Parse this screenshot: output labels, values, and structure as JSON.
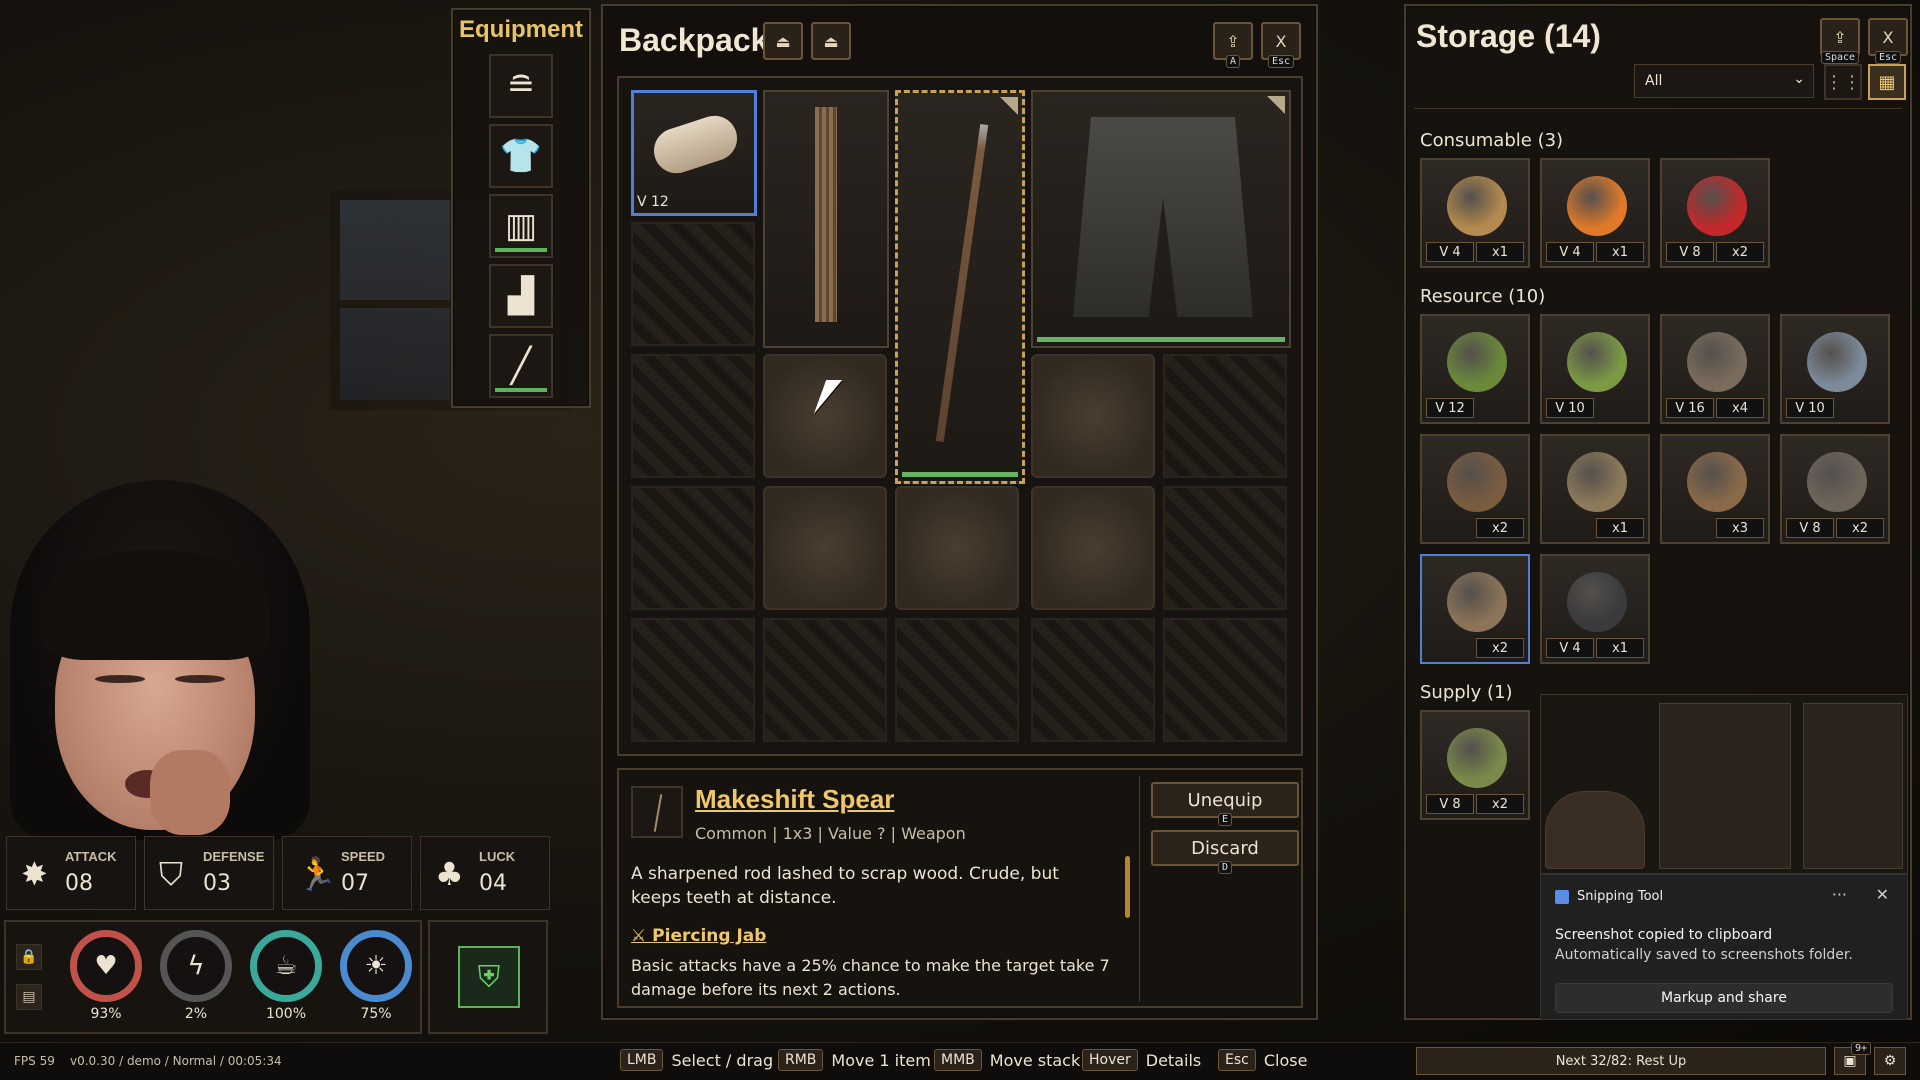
{
  "equipment": {
    "title": "Equipment",
    "slots": [
      {
        "icon": "head-icon",
        "glyph": "≘"
      },
      {
        "icon": "shirt-icon",
        "glyph": "👕"
      },
      {
        "icon": "pants-icon",
        "glyph": "▥"
      },
      {
        "icon": "boot-icon",
        "glyph": "▟"
      },
      {
        "icon": "spear-icon",
        "glyph": "╱"
      }
    ]
  },
  "backpack": {
    "title": "Backpack",
    "sort_buttons": [
      {
        "icon": "sort-icon",
        "glyph": "⏏"
      },
      {
        "icon": "sort-alt-icon",
        "glyph": "⏏"
      }
    ],
    "take_all": {
      "glyph": "⇪",
      "key": "A"
    },
    "close": {
      "label": "X",
      "key": "Esc"
    },
    "items": {
      "cloth_roll": {
        "value": "V 12"
      }
    }
  },
  "detail": {
    "name": "Makeshift Spear",
    "meta": "Common | 1x3 | Value ? | Weapon",
    "description": "A sharpened rod lashed to scrap wood. Crude, but keeps teeth at distance.",
    "ability_name": "Piercing Jab",
    "ability_desc": "Basic attacks have a 25% chance to make the target take 7 damage before its next 2 actions.",
    "unequip": {
      "label": "Unequip",
      "key": "E"
    },
    "discard": {
      "label": "Discard",
      "key": "D"
    }
  },
  "storage": {
    "title": "Storage (14)",
    "filter": "All",
    "take_key": "Space",
    "close": {
      "label": "X",
      "key": "Esc"
    },
    "categories": [
      {
        "label": "Consumable (3)",
        "items": [
          {
            "name": "potato",
            "v": "V 4",
            "q": "x1",
            "color": "#b48a4e"
          },
          {
            "name": "carrot",
            "v": "V 4",
            "q": "x1",
            "color": "#e07a2a"
          },
          {
            "name": "apple",
            "v": "V 8",
            "q": "x2",
            "color": "#c4282a"
          }
        ]
      },
      {
        "label": "Resource (10)",
        "items": [
          {
            "name": "sapling",
            "v": "V 12",
            "q": "",
            "color": "#6a8a3a"
          },
          {
            "name": "seedling",
            "v": "V 10",
            "q": "",
            "color": "#7c9a44"
          },
          {
            "name": "cloth-bundle",
            "v": "V 16",
            "q": "x4",
            "color": "#7a6c5c"
          },
          {
            "name": "tape-roll",
            "v": "V 10",
            "q": "",
            "color": "#7d8a9a"
          },
          {
            "name": "sticks",
            "v": "",
            "q": "x2",
            "color": "#7a5c40"
          },
          {
            "name": "bottle",
            "v": "",
            "q": "x1",
            "color": "#8c7a5a"
          },
          {
            "name": "twigs",
            "v": "",
            "q": "x3",
            "color": "#8a6a48"
          },
          {
            "name": "scrap-wood",
            "v": "V 8",
            "q": "x2",
            "color": "#6e655a"
          },
          {
            "name": "rope",
            "v": "",
            "q": "x2",
            "color": "#8c7458"
          },
          {
            "name": "charcoal",
            "v": "V 4",
            "q": "x1",
            "color": "#3a3a3c"
          }
        ]
      },
      {
        "label": "Supply (1)",
        "items": [
          {
            "name": "herb-bundle",
            "v": "V 8",
            "q": "x2",
            "color": "#7a8a4a"
          }
        ]
      }
    ]
  },
  "stats": [
    {
      "label": "ATTACK",
      "value": "08",
      "glyph": "✸",
      "icon": "attack-icon"
    },
    {
      "label": "DEFENSE",
      "value": "03",
      "glyph": "⛉",
      "icon": "defense-icon"
    },
    {
      "label": "SPEED",
      "value": "07",
      "glyph": "🏃",
      "icon": "speed-icon"
    },
    {
      "label": "LUCK",
      "value": "04",
      "glyph": "♣",
      "icon": "luck-icon"
    }
  ],
  "vitals": [
    {
      "value": "93%",
      "glyph": "♥",
      "color": "#c0524a",
      "icon": "health-icon"
    },
    {
      "value": "2%",
      "glyph": "ϟ",
      "color": "#555555",
      "icon": "energy-icon"
    },
    {
      "value": "100%",
      "glyph": "☕",
      "color": "#3aa89a",
      "icon": "food-icon"
    },
    {
      "value": "75%",
      "glyph": "☀",
      "color": "#4a8ad0",
      "icon": "sanity-icon"
    }
  ],
  "bottom": {
    "fps": "FPS 59",
    "version": "v0.0.30 / demo / Normal / 00:05:34",
    "hints": [
      {
        "key": "LMB",
        "label": "Select / drag"
      },
      {
        "key": "RMB",
        "label": "Move 1 item"
      },
      {
        "key": "MMB",
        "label": "Move stack"
      },
      {
        "key": "Hover",
        "label": "Details"
      },
      {
        "key": "Esc",
        "label": "Close"
      }
    ],
    "next": "Next 32/82: Rest Up",
    "badge": "9+"
  },
  "toast": {
    "app": "Snipping Tool",
    "dots": "···",
    "close": "✕",
    "line1": "Screenshot copied to clipboard",
    "line2": "Automatically saved to screenshots folder.",
    "action": "Markup and share"
  },
  "colors": {
    "accent_gold": "#efc86b",
    "selected_blue": "#4f7fd6",
    "durability_green": "#67b365"
  }
}
